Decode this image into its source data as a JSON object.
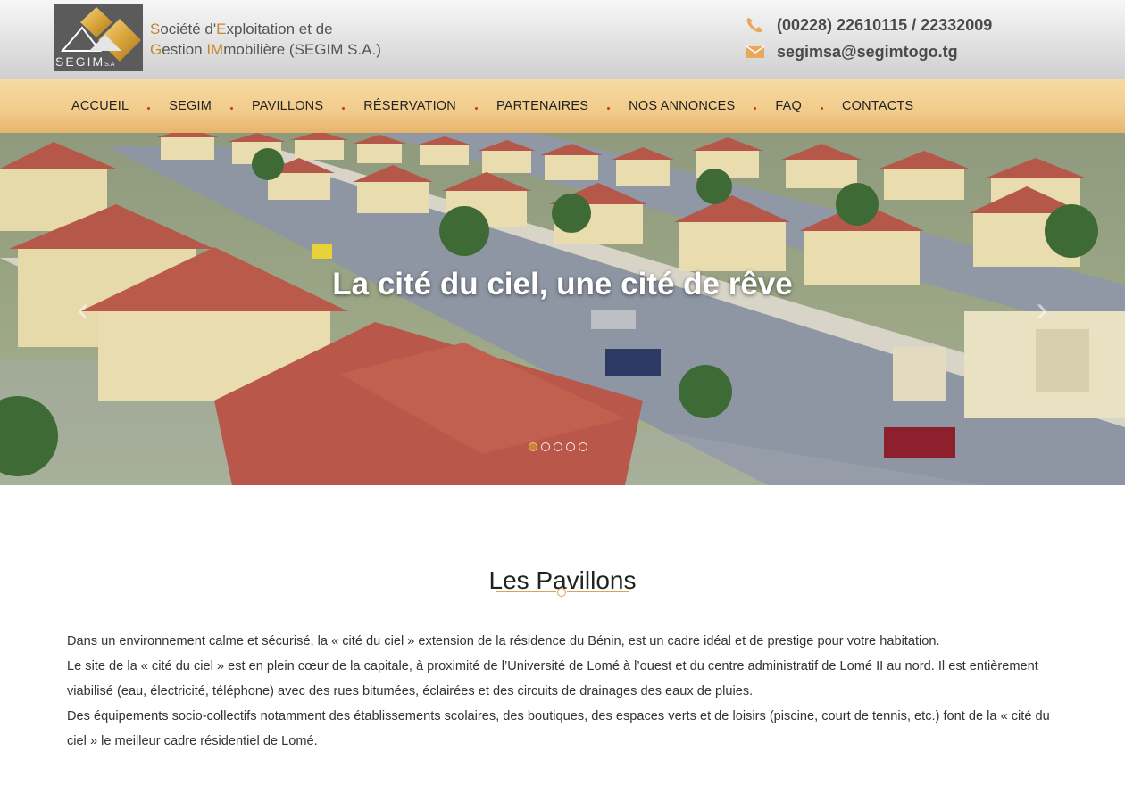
{
  "header": {
    "logo_text": "SEGIM",
    "logo_suffix": "S.A",
    "company_name_line1": "Société d'Exploitation et de",
    "company_name_line2": "Gestion IMmobilière (SEGIM S.A.)",
    "phone": "(00228) 22610115 / 22332009",
    "email": "segimsa@segimtogo.tg",
    "phone_icon": "phone-icon",
    "email_icon": "envelope-icon"
  },
  "nav": {
    "items": [
      {
        "label": "ACCUEIL"
      },
      {
        "label": "SEGIM"
      },
      {
        "label": "PAVILLONS"
      },
      {
        "label": "RÉSERVATION"
      },
      {
        "label": "PARTENAIRES"
      },
      {
        "label": "NOS ANNONCES"
      },
      {
        "label": "FAQ"
      },
      {
        "label": "CONTACTS"
      }
    ]
  },
  "hero": {
    "caption": "La cité du ciel, une cité de rêve",
    "prev_label": "‹",
    "next_label": "›",
    "slide_count": 5,
    "active_slide": 1
  },
  "section": {
    "title": "Les Pavillons",
    "paragraphs": [
      "Dans un environnement calme et sécurisé, la « cité du ciel » extension de la résidence du Bénin, est un cadre idéal et de prestige pour votre habitation.",
      "Le site de la « cité du ciel » est en plein cœur de la capitale, à proximité de l’Université de Lomé à l’ouest et du centre administratif de Lomé II au nord. Il est entièrement viabilisé (eau, électricité, téléphone) avec des rues bitumées, éclairées et des circuits de drainages des eaux de pluies.",
      "Des équipements socio-collectifs notamment des établissements scolaires, des boutiques, des espaces verts et de loisirs (piscine, court de tennis, etc.) font de la « cité du ciel » le meilleur cadre résidentiel de Lomé."
    ]
  },
  "colors": {
    "accent": "#c8872e",
    "nav_bg": "#f1cb8a",
    "roof": "#b5584a"
  }
}
